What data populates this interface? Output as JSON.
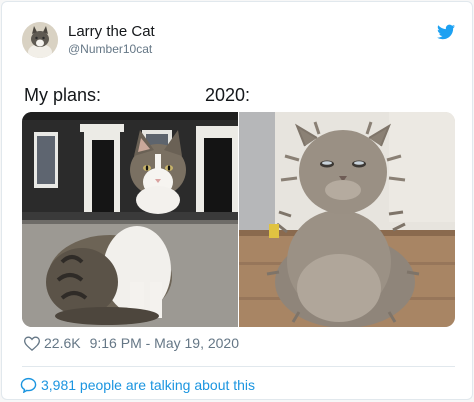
{
  "author": {
    "display_name": "Larry the Cat",
    "handle": "@Number10cat",
    "avatar_icon": "cat-avatar",
    "logo_icon": "twitter-bird-icon"
  },
  "tweet": {
    "caption_left": "My plans:",
    "caption_right": "2020:",
    "images": [
      {
        "icon": "tabby-cat-photo",
        "description_visible": false
      },
      {
        "icon": "fluffy-cat-photo",
        "description_visible": false
      }
    ]
  },
  "meta": {
    "likes": "22.6K",
    "timestamp": "9:16 PM - May 19, 2020",
    "heart_icon": "heart-icon"
  },
  "conversation": {
    "label": "3,981 people are talking about this",
    "icon": "speech-bubble-icon"
  },
  "colors": {
    "accent": "#1b95e0",
    "muted_text": "#657786",
    "border": "#e1e8ed"
  }
}
